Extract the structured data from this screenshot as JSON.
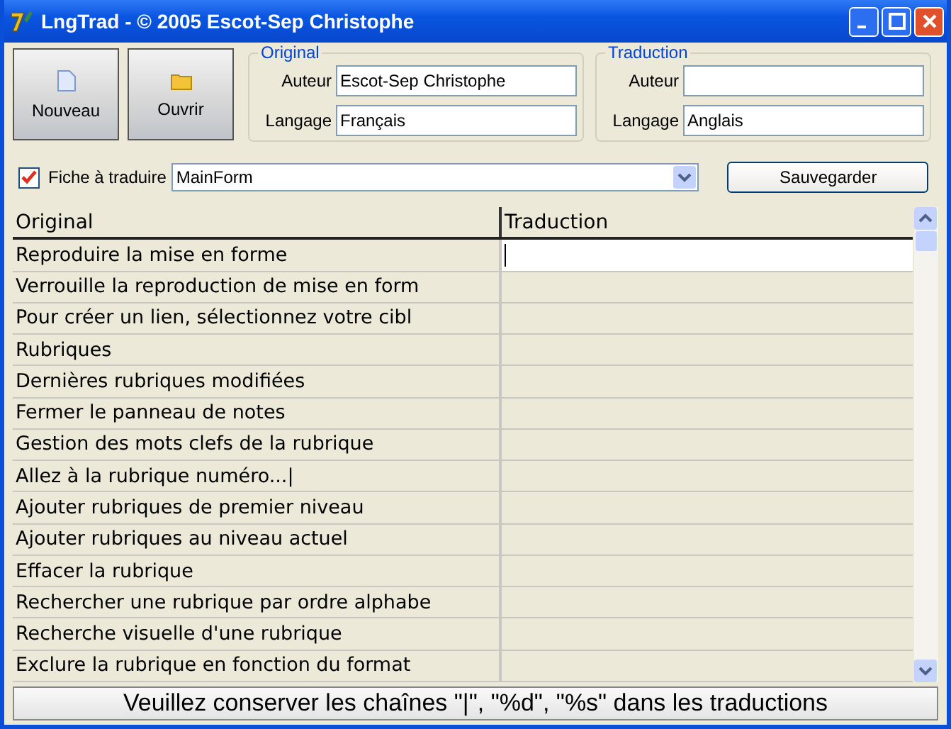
{
  "window": {
    "title": "LngTrad - © 2005 Escot-Sep Christophe"
  },
  "toolbar": [
    {
      "label": "Nouveau",
      "kind": "new"
    },
    {
      "label": "Ouvrir",
      "kind": "open"
    }
  ],
  "original": {
    "title": "Original",
    "author_label": "Auteur",
    "author": "Escot-Sep Christophe",
    "language_label": "Langage",
    "language": "Français"
  },
  "translation": {
    "title": "Traduction",
    "author_label": "Auteur",
    "language_label": "Langage",
    "language": "Anglais"
  },
  "form_select": {
    "label": "Fiche à traduire",
    "checked": true,
    "value": "MainForm"
  },
  "save_button": "Sauvegarder",
  "table": {
    "columns": [
      "Original",
      "Traduction"
    ],
    "rows": [
      {
        "original": "Reproduire la mise en forme",
        "selected": true
      },
      {
        "original": "Verrouille la reproduction de mise en form",
        "selected": false
      },
      {
        "original": "Pour créer un lien, sélectionnez votre cibl",
        "selected": false
      },
      {
        "original": "Rubriques",
        "selected": false
      },
      {
        "original": "Dernières rubriques modifiées",
        "selected": false
      },
      {
        "original": "Fermer le panneau de notes",
        "selected": false
      },
      {
        "original": "Gestion des mots clefs de la rubrique",
        "selected": false
      },
      {
        "original": "Allez à la rubrique numéro...|",
        "selected": false
      },
      {
        "original": "Ajouter rubriques de premier niveau",
        "selected": false
      },
      {
        "original": "Ajouter rubriques au niveau actuel",
        "selected": false
      },
      {
        "original": "Effacer la rubrique",
        "selected": false
      },
      {
        "original": "Rechercher une rubrique par ordre alphabe",
        "selected": false
      },
      {
        "original": "Recherche visuelle d'une rubrique",
        "selected": false
      },
      {
        "original": "Exclure la rubrique en fonction du format",
        "selected": false
      }
    ]
  },
  "status_bar": "Veuillez conserver les chaînes \"|\", \"%d\", \"%s\" dans les traductions"
}
